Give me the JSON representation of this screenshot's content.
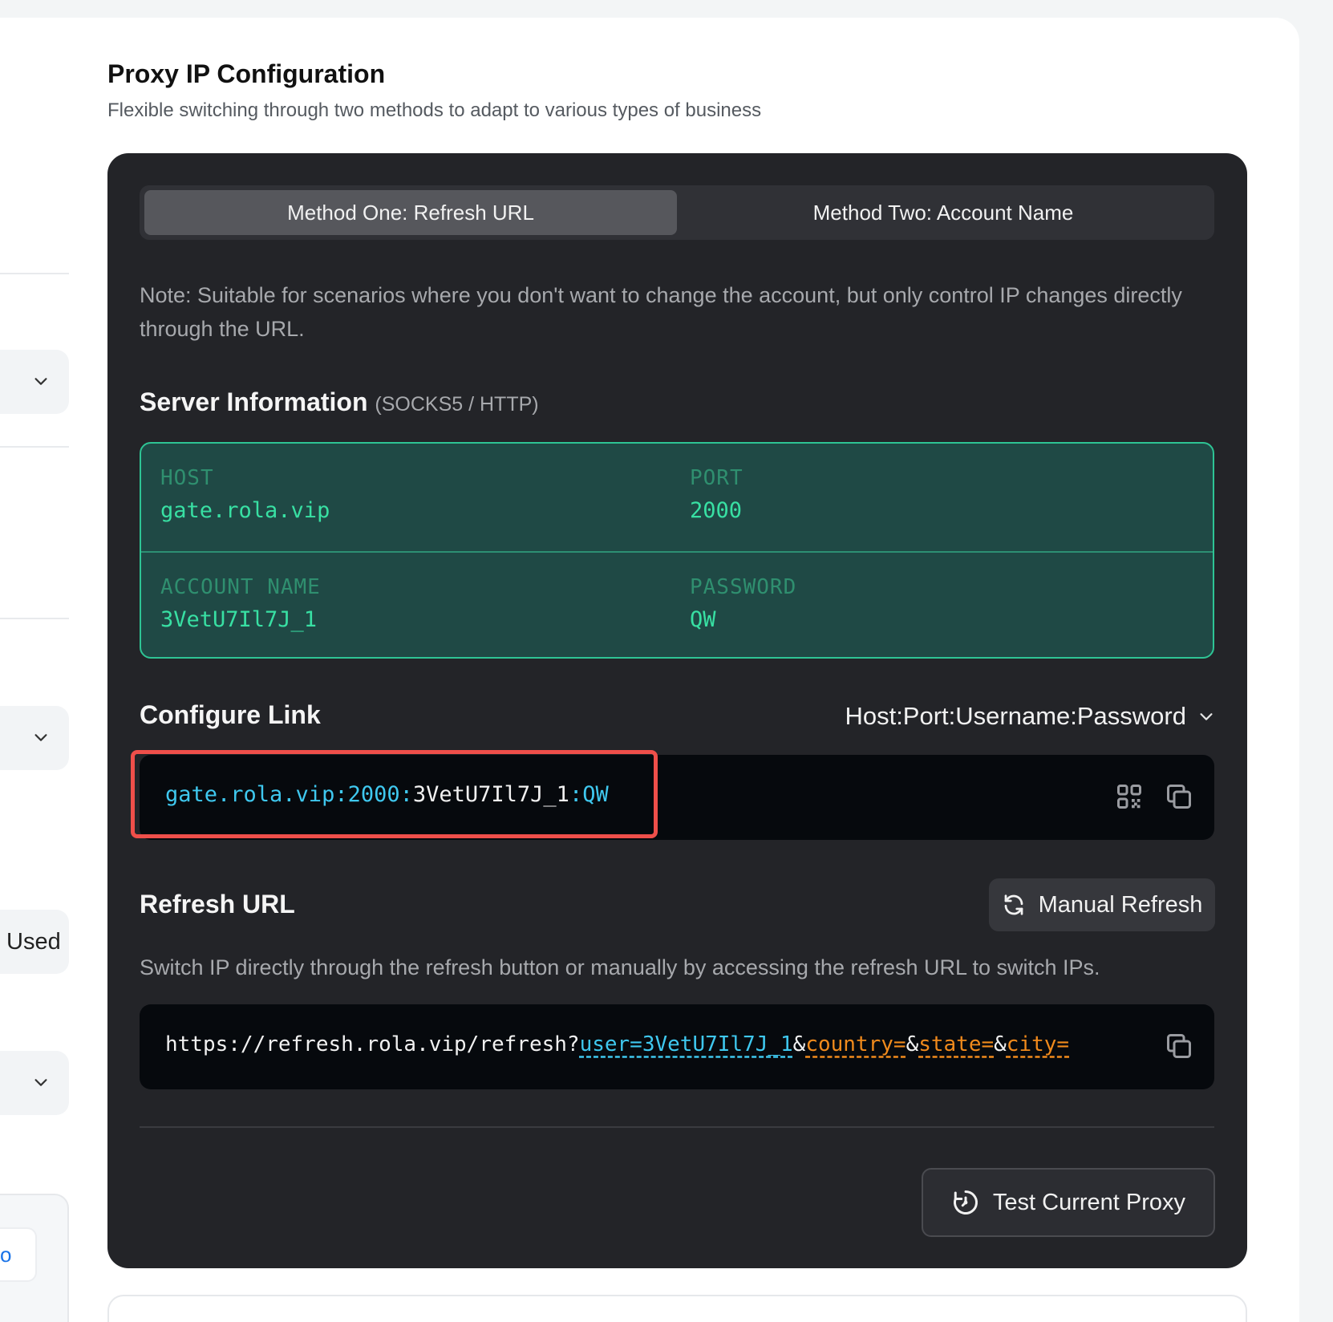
{
  "header": {
    "title": "Proxy IP Configuration",
    "subtitle": "Flexible switching through two methods to adapt to various types of business"
  },
  "left_partial": {
    "used_label": "Used",
    "box_text": "o"
  },
  "tabs": [
    {
      "label": "Method One: Refresh URL",
      "active": true
    },
    {
      "label": "Method Two: Account Name",
      "active": false
    }
  ],
  "note": "Note: Suitable for scenarios where you don't want to change the account, but only control IP changes directly through the URL.",
  "server": {
    "title": "Server Information",
    "protocols": "(SOCKS5 / HTTP)",
    "host_label": "HOST",
    "host": "gate.rola.vip",
    "port_label": "PORT",
    "port": "2000",
    "account_label": "ACCOUNT NAME",
    "account": "3VetU7Il7J_1",
    "password_label": "PASSWORD",
    "password": "QW"
  },
  "configure": {
    "title": "Configure Link",
    "format": "Host:Port:Username:Password",
    "link_host_port": "gate.rola.vip:2000:",
    "link_user": "3VetU7Il7J_1",
    "link_pass": ":QW"
  },
  "refresh": {
    "title": "Refresh URL",
    "button": "Manual Refresh",
    "description": "Switch IP directly through the refresh button or manually by accessing the refresh URL to switch IPs.",
    "url_base": "https://refresh.rola.vip/refresh?",
    "url_user": "user=3VetU7Il7J_1",
    "amp": "&",
    "url_country": "country=",
    "url_state": "state=",
    "url_city": "city="
  },
  "test_button": "Test Current Proxy",
  "colors": {
    "panel_bg": "#232428",
    "accent_green": "#38e0a3",
    "accent_cyan": "#3fc8ef",
    "accent_orange": "#f08a1c",
    "highlight_red": "#ef4f4a"
  }
}
